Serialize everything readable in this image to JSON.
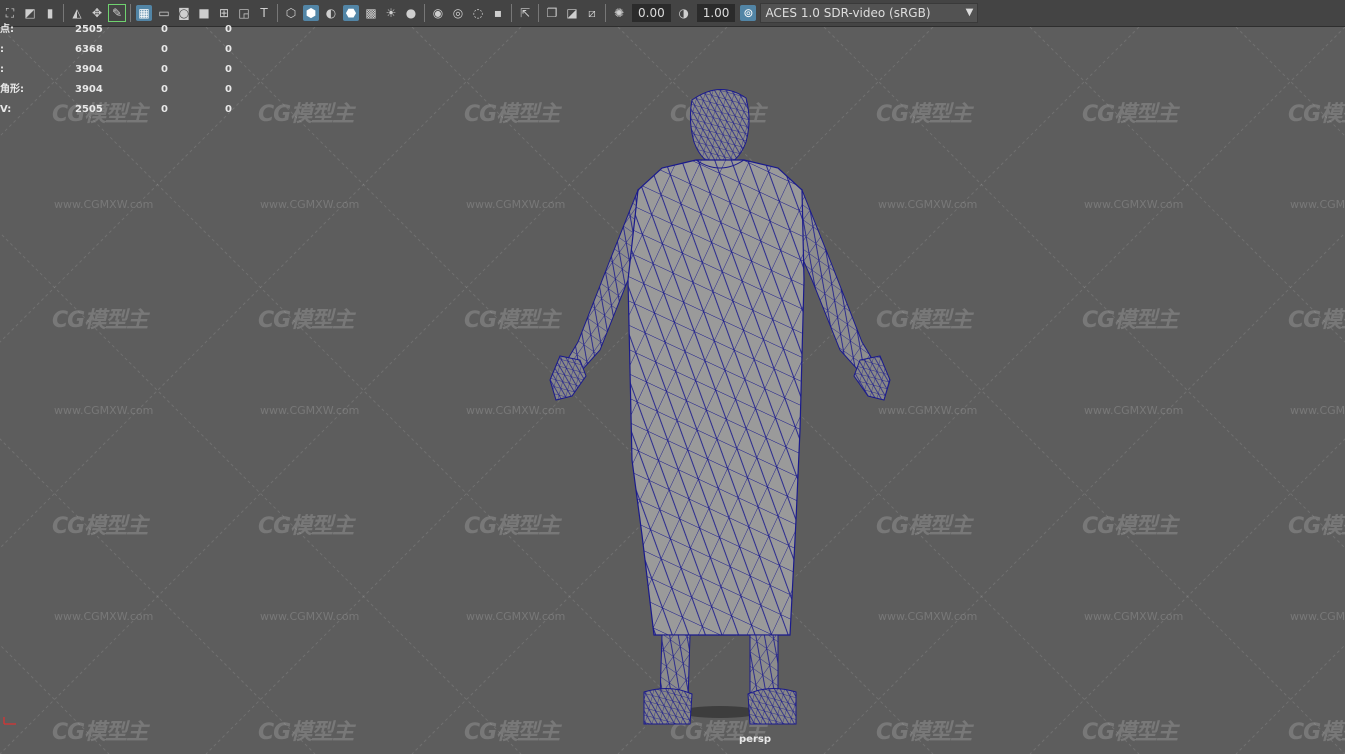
{
  "toolbar": {
    "exposure_value": "0.00",
    "gamma_value": "1.00",
    "color_space": "ACES 1.0 SDR-video (sRGB)",
    "icons": [
      "camera-select-icon",
      "camera-attr-icon",
      "bookmark-icon",
      "image-plane-icon",
      "grease-pencil-icon",
      "2d-pan-zoom-icon",
      "grid-icon",
      "film-gate-icon",
      "resolution-gate-icon",
      "gate-mask-icon",
      "field-chart-icon",
      "safe-action-icon",
      "safe-title-icon",
      "wireframe-icon",
      "smooth-shade-icon",
      "default-material-icon",
      "wireframe-on-shaded-icon",
      "textured-icon",
      "lighting-icon",
      "shadows-icon",
      "ambient-occlusion-icon",
      "motion-blur-icon",
      "anti-aliasing-icon",
      "depth-of-field-icon",
      "isolate-select-icon",
      "xray-icon",
      "xray-active-icon",
      "xray-joints-icon",
      "exposure-icon",
      "gamma-icon",
      "color-management-icon"
    ]
  },
  "hud": {
    "rows": [
      {
        "label": "点:",
        "c1": "2505",
        "c2": "0",
        "c3": "0"
      },
      {
        "label": ":",
        "c1": "6368",
        "c2": "0",
        "c3": "0"
      },
      {
        "label": ":",
        "c1": "3904",
        "c2": "0",
        "c3": "0"
      },
      {
        "label": "角形:",
        "c1": "3904",
        "c2": "0",
        "c3": "0"
      },
      {
        "label": "V:",
        "c1": "2505",
        "c2": "0",
        "c3": "0"
      }
    ]
  },
  "watermark": {
    "logo": "CG模型主",
    "url": "www.CGMXW.com"
  },
  "viewport": {
    "camera_label": "persp"
  },
  "colors": {
    "viewport_bg": "#5d5d5d",
    "wireframe": "#1a1a8c",
    "mesh": "#9a9a9a",
    "toolbar_bg": "#444444",
    "active_icon": "#5285a6"
  }
}
